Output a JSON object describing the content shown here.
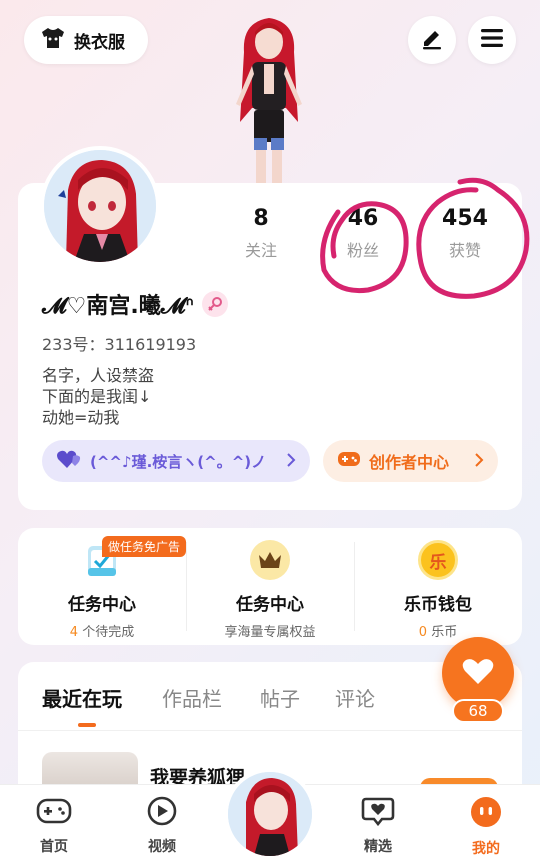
{
  "header": {
    "wardrobe_label": "换衣服",
    "edit_icon": "pencil-icon",
    "menu_icon": "hamburger-menu-icon"
  },
  "profile": {
    "stats": [
      {
        "value": "8",
        "label": "关注"
      },
      {
        "value": "46",
        "label": "粉丝"
      },
      {
        "value": "454",
        "label": "获赞"
      }
    ],
    "name": "𝓜♡南宫.曦𝓜ᐢ",
    "gender_icon": "female-symbol-icon",
    "uid": "233号：311619193",
    "bio_lines": [
      "名字，人设禁盗",
      "下面的是我闺↓",
      "动她=动我"
    ],
    "guild_label": "(^^♪瑾.桉言ヽ(^。^)ノ",
    "creator_label": "创作者中心"
  },
  "tasks": {
    "ad_badge": "做任务免广告",
    "items": [
      {
        "title": "任务中心",
        "sub_highlight": "4",
        "sub": "个待完成",
        "icon": "clipboard-check-icon"
      },
      {
        "title": "任务中心",
        "sub_highlight": "",
        "sub": "享海量专属权益",
        "icon": "crown-icon"
      },
      {
        "title": "乐币钱包",
        "sub_highlight": "0",
        "sub": "乐币",
        "icon": "le-coin-icon",
        "coin_char": "乐"
      }
    ]
  },
  "content_tabs": [
    "最近在玩",
    "作品栏",
    "帖子",
    "评论"
  ],
  "recent_game": {
    "title": "我要养狐狸"
  },
  "like_fab": {
    "count": "68"
  },
  "bottom_nav": [
    {
      "label": "首页",
      "icon": "gamepad-icon"
    },
    {
      "label": "视频",
      "icon": "play-video-icon"
    },
    {
      "label": "",
      "icon": "avatar"
    },
    {
      "label": "精选",
      "icon": "heart-chat-icon"
    },
    {
      "label": "我的",
      "icon": "profile-face-icon"
    }
  ],
  "colors": {
    "accent": "#F36B1D",
    "guild_text": "#6A5AD8",
    "annotation": "#D6246E"
  }
}
